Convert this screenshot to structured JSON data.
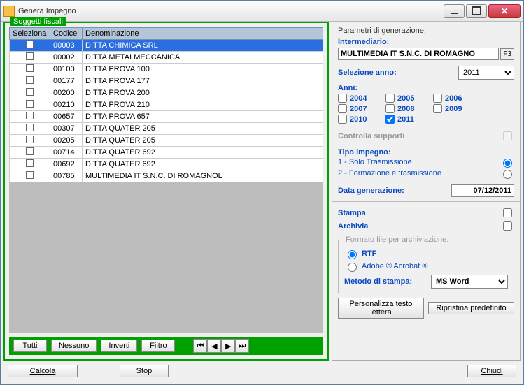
{
  "window": {
    "title": "Genera Impegno"
  },
  "left": {
    "legend": "Soggetti fiscali",
    "columns": {
      "c0": "Seleziona",
      "c1": "Codice",
      "c2": "Denominazione"
    },
    "rows": [
      {
        "code": "00003",
        "name": "DITTA CHIMICA SRL",
        "selected": true
      },
      {
        "code": "00002",
        "name": "DITTA METALMECCANICA"
      },
      {
        "code": "00100",
        "name": "DITTA PROVA 100"
      },
      {
        "code": "00177",
        "name": "DITTA PROVA 177"
      },
      {
        "code": "00200",
        "name": "DITTA PROVA 200"
      },
      {
        "code": "00210",
        "name": "DITTA PROVA 210"
      },
      {
        "code": "00657",
        "name": "DITTA PROVA 657"
      },
      {
        "code": "00307",
        "name": "DITTA QUATER 205"
      },
      {
        "code": "00205",
        "name": "DITTA QUATER 205"
      },
      {
        "code": "00714",
        "name": "DITTA QUATER 692"
      },
      {
        "code": "00692",
        "name": "DITTA QUATER 692"
      },
      {
        "code": "00785",
        "name": "MULTIMEDIA IT S.N.C. DI ROMAGNOL"
      }
    ],
    "toolbar": {
      "all": "Tutti",
      "none": "Nessuno",
      "invert": "Inverti",
      "filter": "Filtro"
    }
  },
  "right": {
    "title": "Parametri di generazione:",
    "intermediario_label": "Intermediario:",
    "intermediario_value": "MULTIMEDIA IT S.N.C. DI ROMAGNO",
    "f3": "F3",
    "selezione_anno_label": "Selezione anno:",
    "selezione_anno_value": "2011",
    "anni_label": "Anni:",
    "years": {
      "y2004": "2004",
      "y2005": "2005",
      "y2006": "2006",
      "y2007": "2007",
      "y2008": "2008",
      "y2009": "2009",
      "y2010": "2010",
      "y2011": "2011"
    },
    "year_checked": "2011",
    "controlla_supporti": "Controlla supporti",
    "tipo_impegno_label": "Tipo impegno:",
    "tipo1": "1 - Solo Trasmissione",
    "tipo2": "2 - Formazione e trasmissione",
    "data_gen_label": "Data generazione:",
    "data_gen_value": "07/12/2011",
    "stampa": "Stampa",
    "archivia": "Archivia",
    "formato_legend": "Formato file per archiviazione:",
    "rtf": "RTF",
    "adobe": "Adobe ® Acrobat ®",
    "metodo_label": "Metodo di stampa:",
    "metodo_value": "MS Word",
    "personalizza": "Personalizza testo lettera",
    "ripristina": "Ripristina predefinito"
  },
  "footer": {
    "calcola": "Calcola",
    "stop": "Stop",
    "chiudi": "Chiudi"
  }
}
